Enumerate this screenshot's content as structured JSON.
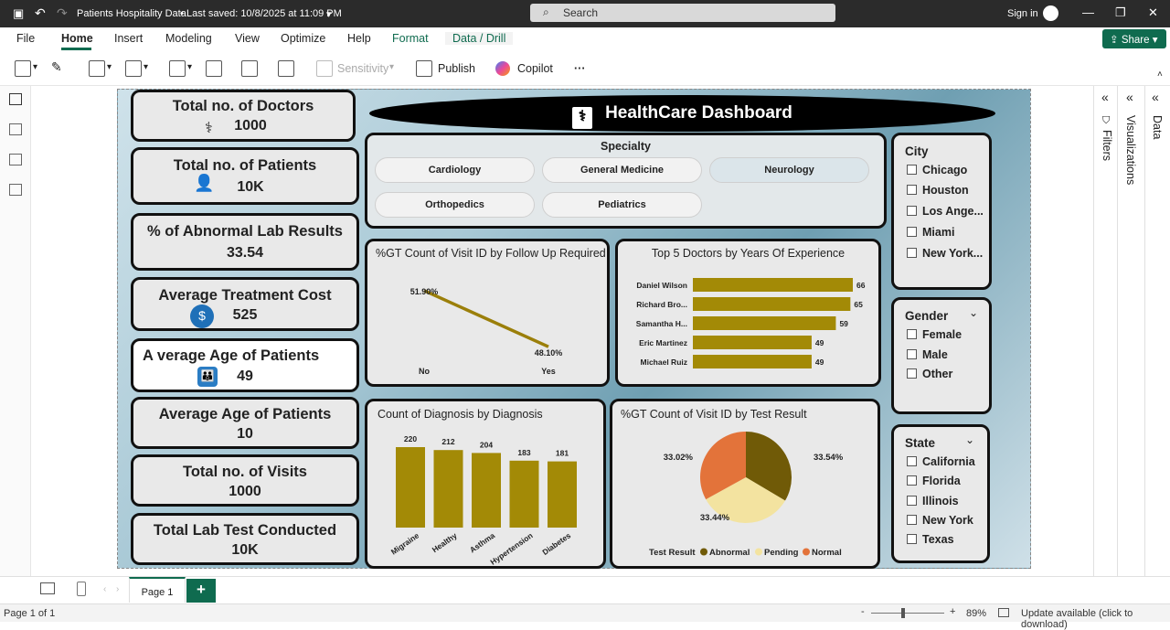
{
  "titlebar": {
    "doc_title": "Patients Hospitality Data",
    "saved": "Last saved: 10/8/2025 at 11:09 PM",
    "search": "Search",
    "signin": "Sign in"
  },
  "menu": {
    "items": [
      "File",
      "Home",
      "Insert",
      "Modeling",
      "View",
      "Optimize",
      "Help",
      "Format",
      "Data / Drill"
    ],
    "share": "Share"
  },
  "ribbon": {
    "sensitivity": "Sensitivity",
    "publish": "Publish",
    "copilot": "Copilot",
    "more": "···"
  },
  "report": {
    "banner": "HealthCare Dashboard",
    "kpis": [
      {
        "title": "Total no. of Doctors",
        "value": "1000"
      },
      {
        "title": "Total no. of Patients",
        "value": "10K"
      },
      {
        "title": "% of Abnormal Lab Results",
        "value": "33.54"
      },
      {
        "title": "Average Treatment Cost",
        "value": "525"
      },
      {
        "title": "A verage Age of Patients",
        "value": "49"
      },
      {
        "title": "Average Age of Patients",
        "value": "10"
      },
      {
        "title": "Total no. of Visits",
        "value": "1000"
      },
      {
        "title": "Total Lab Test Conducted",
        "value": "10K"
      }
    ],
    "specialty": {
      "title": "Specialty",
      "items": [
        "Cardiology",
        "General Medicine",
        "Neurology",
        "Orthopedics",
        "Pediatrics"
      ]
    },
    "city": {
      "title": "City",
      "items": [
        "Chicago",
        "Houston",
        "Los Ange...",
        "Miami",
        "New York..."
      ]
    },
    "gender": {
      "title": "Gender",
      "items": [
        "Female",
        "Male",
        "Other"
      ]
    },
    "state": {
      "title": "State",
      "items": [
        "California",
        "Florida",
        "Illinois",
        "New York",
        "Texas"
      ]
    }
  },
  "chart_data": [
    {
      "type": "line",
      "title": "%GT Count of Visit ID by Follow Up Required",
      "x": [
        "No",
        "Yes"
      ],
      "values": [
        51.9,
        48.1
      ],
      "data_labels": [
        "51.90%",
        "48.10%"
      ],
      "color": "#9b7f0a"
    },
    {
      "type": "bar",
      "orientation": "horizontal",
      "title": "Top 5 Doctors by Years Of Experience",
      "categories": [
        "Daniel Wilson",
        "Richard Bro...",
        "Samantha H...",
        "Eric Martinez",
        "Michael Ruiz"
      ],
      "values": [
        66,
        65,
        59,
        49,
        49
      ],
      "color": "#a38a06"
    },
    {
      "type": "bar",
      "title": "Count of Diagnosis by Diagnosis",
      "categories": [
        "Migraine",
        "Healthy",
        "Asthma",
        "Hypertension",
        "Diabetes"
      ],
      "values": [
        220,
        212,
        204,
        183,
        181
      ],
      "color": "#a38a06"
    },
    {
      "type": "pie",
      "title": "%GT Count of Visit ID by Test Result",
      "legend_title": "Test Result",
      "labels": [
        "Abnormal",
        "Pending",
        "Normal"
      ],
      "values": [
        33.54,
        33.44,
        33.02
      ],
      "data_labels": [
        "33.54%",
        "33.44%",
        "33.02%"
      ],
      "colors": [
        "#705a07",
        "#f3e3a0",
        "#e3733a"
      ]
    }
  ],
  "pages": {
    "tab": "Page 1",
    "add": "+"
  },
  "status": {
    "page": "Page 1 of 1",
    "zoom": "89%",
    "update": "Update available (click to download)"
  },
  "panes": {
    "filters": "Filters",
    "visualizations": "Visualizations",
    "data": "Data"
  }
}
